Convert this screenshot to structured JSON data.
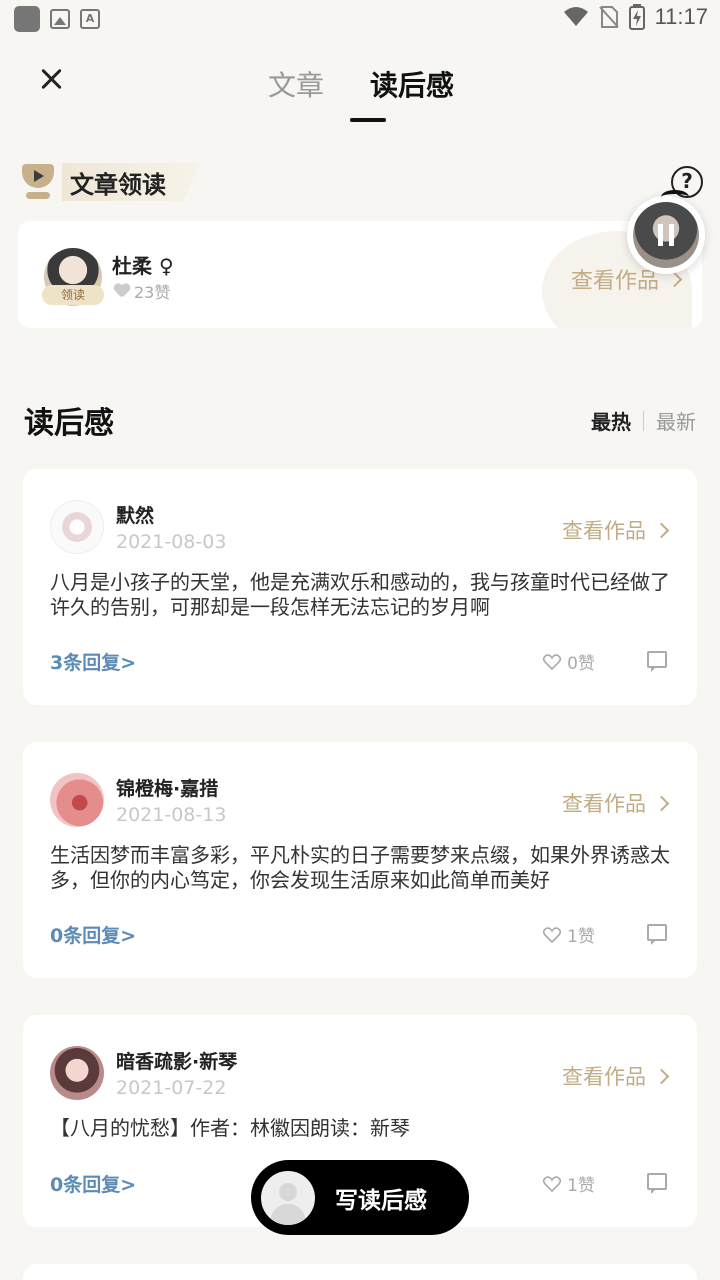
{
  "status_bar": {
    "time": "11:17"
  },
  "header": {
    "tabs": [
      {
        "label": "文章",
        "active": false
      },
      {
        "label": "读后感",
        "active": true
      }
    ]
  },
  "guide": {
    "title": "文章领读",
    "help": "?",
    "reader": {
      "name": "杜柔 ♀",
      "badge": "领读",
      "likes": "23赞",
      "view_label": "查看作品"
    }
  },
  "section": {
    "title": "读后感",
    "sort_hot": "最热",
    "sort_new": "最新"
  },
  "comments": [
    {
      "name": "默然",
      "date": "2021-08-03",
      "view_label": "查看作品",
      "content": "八月是小孩子的天堂，他是充满欢乐和感动的，我与孩童时代已经做了许久的告别，可那却是一段怎样无法忘记的岁月啊",
      "replies": "3条回复>",
      "likes": "0赞"
    },
    {
      "name": "锦橙梅·嘉措",
      "date": "2021-08-13",
      "view_label": "查看作品",
      "content": "生活因梦而丰富多彩，平凡朴实的日子需要梦来点缀，如果外界诱惑太多，但你的内心笃定，你会发现生活原来如此简单而美好",
      "replies": "0条回复>",
      "likes": "1赞"
    },
    {
      "name": "暗香疏影·新琴",
      "date": "2021-07-22",
      "view_label": "查看作品",
      "content": "【八月的忧愁】作者：林徽因朗读：新琴",
      "replies": "0条回复>",
      "likes": "1赞"
    }
  ],
  "write_button": {
    "label": "写读后感"
  },
  "colors": {
    "accent_gold": "#c2ab85",
    "reply_blue": "#5b8bb6",
    "background": "#f7f6f2"
  }
}
